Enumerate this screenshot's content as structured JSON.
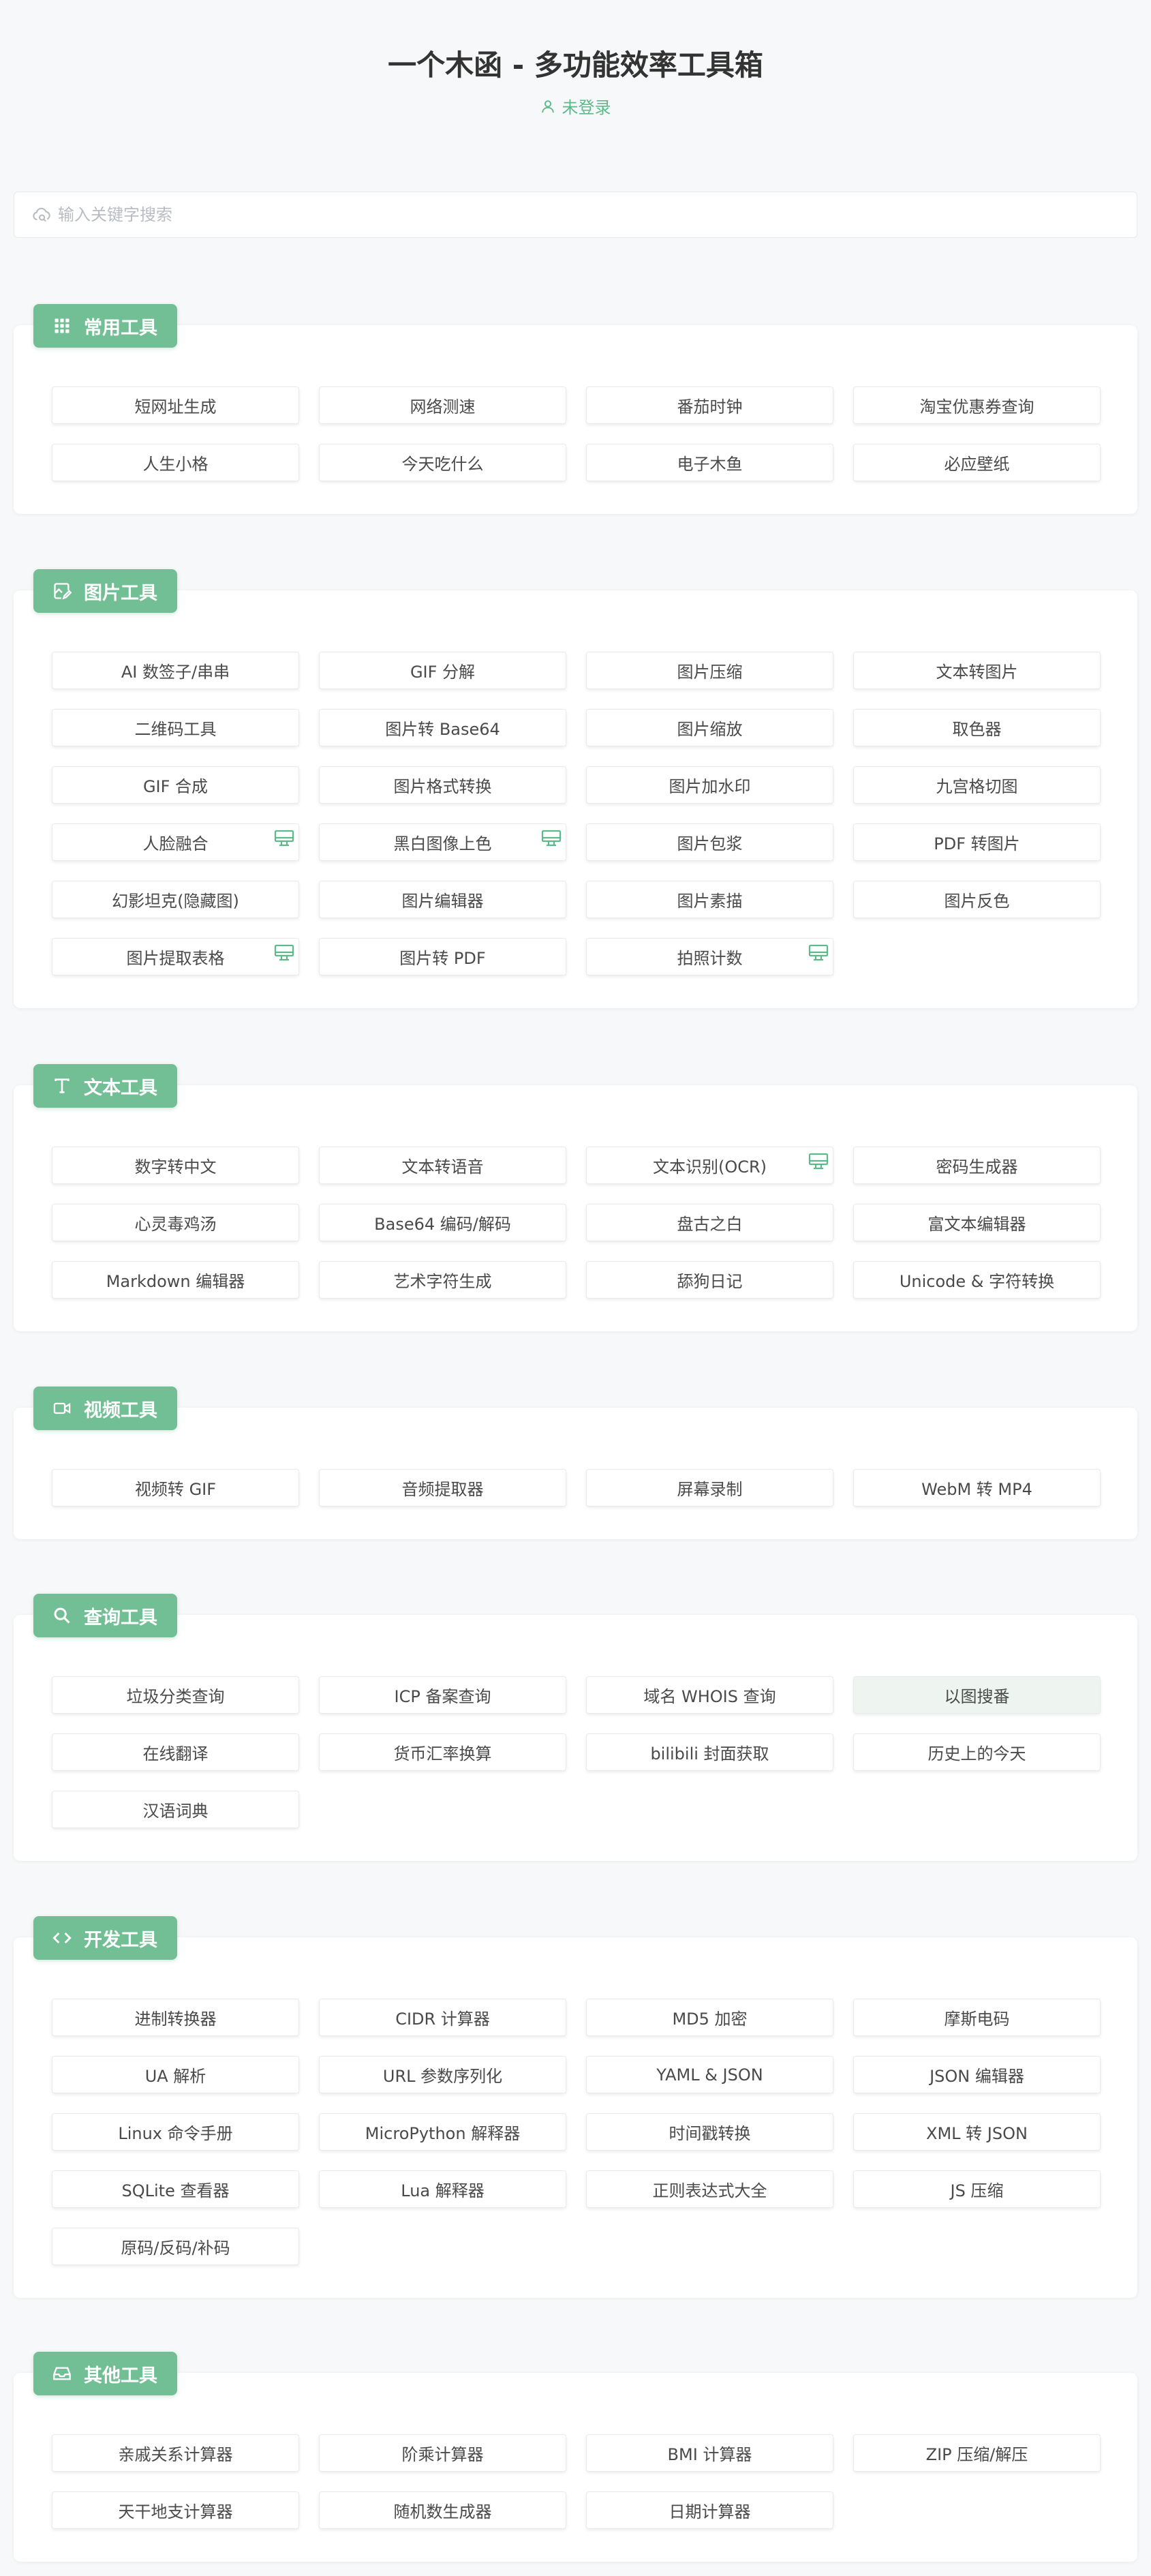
{
  "header": {
    "title": "一个木函 - 多功能效率工具箱",
    "login_text": "未登录"
  },
  "search": {
    "placeholder": "输入关键字搜索"
  },
  "colors": {
    "accent": "#73bf95",
    "accent_text": "#5cb98a"
  },
  "sections": [
    {
      "title": "常用工具",
      "icon": "grid-icon",
      "tools": [
        {
          "label": "短网址生成"
        },
        {
          "label": "网络测速"
        },
        {
          "label": "番茄时钟"
        },
        {
          "label": "淘宝优惠券查询"
        },
        {
          "label": "人生小格"
        },
        {
          "label": "今天吃什么"
        },
        {
          "label": "电子木鱼"
        },
        {
          "label": "必应壁纸"
        }
      ]
    },
    {
      "title": "图片工具",
      "icon": "image-edit-icon",
      "tools": [
        {
          "label": "AI 数签子/串串"
        },
        {
          "label": "GIF 分解"
        },
        {
          "label": "图片压缩"
        },
        {
          "label": "文本转图片"
        },
        {
          "label": "二维码工具"
        },
        {
          "label": "图片转 Base64"
        },
        {
          "label": "图片缩放"
        },
        {
          "label": "取色器"
        },
        {
          "label": "GIF 合成"
        },
        {
          "label": "图片格式转换"
        },
        {
          "label": "图片加水印"
        },
        {
          "label": "九宫格切图"
        },
        {
          "label": "人脸融合",
          "desktop": true
        },
        {
          "label": "黑白图像上色",
          "desktop": true
        },
        {
          "label": "图片包浆"
        },
        {
          "label": "PDF 转图片"
        },
        {
          "label": "幻影坦克(隐藏图)"
        },
        {
          "label": "图片编辑器"
        },
        {
          "label": "图片素描"
        },
        {
          "label": "图片反色"
        },
        {
          "label": "图片提取表格",
          "desktop": true
        },
        {
          "label": "图片转 PDF"
        },
        {
          "label": "拍照计数",
          "desktop": true
        }
      ]
    },
    {
      "title": "文本工具",
      "icon": "text-icon",
      "tools": [
        {
          "label": "数字转中文"
        },
        {
          "label": "文本转语音"
        },
        {
          "label": "文本识别(OCR)",
          "desktop": true
        },
        {
          "label": "密码生成器"
        },
        {
          "label": "心灵毒鸡汤"
        },
        {
          "label": "Base64 编码/解码"
        },
        {
          "label": "盘古之白"
        },
        {
          "label": "富文本编辑器"
        },
        {
          "label": "Markdown 编辑器"
        },
        {
          "label": "艺术字符生成"
        },
        {
          "label": "舔狗日记"
        },
        {
          "label": "Unicode & 字符转换"
        }
      ]
    },
    {
      "title": "视频工具",
      "icon": "video-icon",
      "tools": [
        {
          "label": "视频转 GIF"
        },
        {
          "label": "音频提取器"
        },
        {
          "label": "屏幕录制"
        },
        {
          "label": "WebM 转 MP4"
        }
      ]
    },
    {
      "title": "查询工具",
      "icon": "search-icon",
      "tools": [
        {
          "label": "垃圾分类查询"
        },
        {
          "label": "ICP 备案查询"
        },
        {
          "label": "域名 WHOIS 查询"
        },
        {
          "label": "以图搜番",
          "active": true
        },
        {
          "label": "在线翻译"
        },
        {
          "label": "货币汇率换算"
        },
        {
          "label": "bilibili 封面获取"
        },
        {
          "label": "历史上的今天"
        },
        {
          "label": "汉语词典"
        }
      ]
    },
    {
      "title": "开发工具",
      "icon": "code-icon",
      "tools": [
        {
          "label": "进制转换器"
        },
        {
          "label": "CIDR 计算器"
        },
        {
          "label": "MD5 加密"
        },
        {
          "label": "摩斯电码"
        },
        {
          "label": "UA 解析"
        },
        {
          "label": "URL 参数序列化"
        },
        {
          "label": "YAML & JSON"
        },
        {
          "label": "JSON 编辑器"
        },
        {
          "label": "Linux 命令手册"
        },
        {
          "label": "MicroPython 解释器"
        },
        {
          "label": "时间戳转换"
        },
        {
          "label": "XML 转 JSON"
        },
        {
          "label": "SQLite 查看器"
        },
        {
          "label": "Lua 解释器"
        },
        {
          "label": "正则表达式大全"
        },
        {
          "label": "JS 压缩"
        },
        {
          "label": "原码/反码/补码"
        }
      ]
    },
    {
      "title": "其他工具",
      "icon": "inbox-icon",
      "tools": [
        {
          "label": "亲戚关系计算器"
        },
        {
          "label": "阶乘计算器"
        },
        {
          "label": "BMI 计算器"
        },
        {
          "label": "ZIP 压缩/解压"
        },
        {
          "label": "天干地支计算器"
        },
        {
          "label": "随机数生成器"
        },
        {
          "label": "日期计算器"
        }
      ]
    }
  ]
}
